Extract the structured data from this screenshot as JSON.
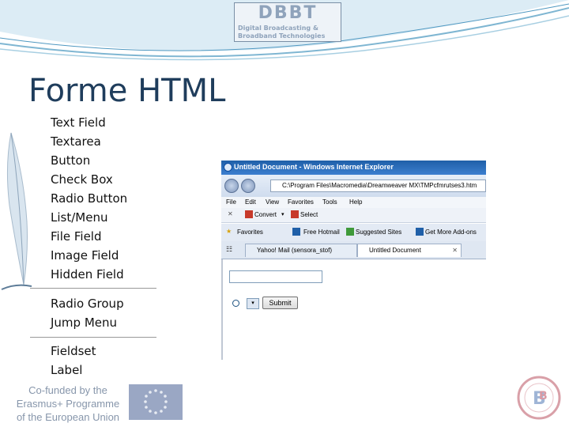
{
  "logo": {
    "title": "DBBT",
    "subtitle_line1": "Digital Broadcasting &",
    "subtitle_line2": "Broadband Technologies"
  },
  "slide_title": "Forme HTML",
  "insert_menu": {
    "group1": [
      "Text Field",
      "Textarea",
      "Button",
      "Check Box",
      "Radio Button",
      "List/Menu",
      "File Field",
      "Image Field",
      "Hidden Field"
    ],
    "group2": [
      "Radio Group",
      "Jump Menu"
    ],
    "group3": [
      "Fieldset",
      "Label"
    ]
  },
  "browser": {
    "window_title": "Untitled Document - Windows Internet Explorer",
    "address": "C:\\Program Files\\Macromedia\\Dreamweaver MX\\TMPcfmrutses3.htm",
    "menu": [
      "File",
      "Edit",
      "View",
      "Favorites",
      "Tools",
      "Help"
    ],
    "command_bar": {
      "convert": "Convert",
      "select": "Select"
    },
    "favorites_bar": {
      "favorites": "Favorites",
      "free_hotmail": "Free Hotmail",
      "suggested_sites": "Suggested Sites",
      "get_more": "Get More Add-ons"
    },
    "tabs": [
      {
        "label": "Yahoo! Mail (sensora_stof)"
      },
      {
        "label": "Untitled Document"
      }
    ],
    "form": {
      "submit_label": "Submit"
    }
  },
  "footer": {
    "erasmus_line1": "Co-funded by the",
    "erasmus_line2": "Erasmus+ Programme",
    "erasmus_line3": "of the European Union"
  },
  "colors": {
    "title": "#1f3d5c",
    "accent": "#1f5fa8"
  }
}
